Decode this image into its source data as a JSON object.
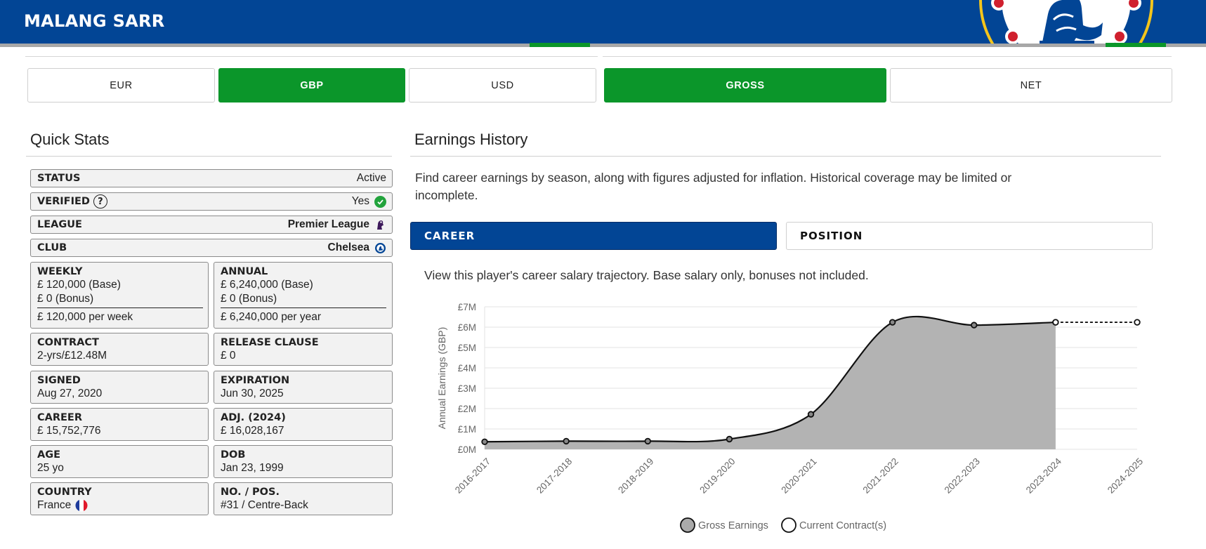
{
  "header": {
    "player_name": "MALANG SARR"
  },
  "currency_toggle": [
    "EUR",
    "GBP",
    "USD"
  ],
  "currency_active": "GBP",
  "pay_toggle": [
    "GROSS",
    "NET"
  ],
  "pay_active": "GROSS",
  "quick_stats": {
    "title": "Quick Stats",
    "rows": {
      "status": {
        "label": "STATUS",
        "value": "Active"
      },
      "verified": {
        "label": "VERIFIED",
        "help": "?",
        "value": "Yes"
      },
      "league": {
        "label": "LEAGUE",
        "value": "Premier League"
      },
      "club": {
        "label": "CLUB",
        "value": "Chelsea"
      }
    },
    "weekly": {
      "label": "WEEKLY",
      "base": "£ 120,000 (Base)",
      "bonus": "£ 0 (Bonus)",
      "total": "£ 120,000 per week"
    },
    "annual": {
      "label": "ANNUAL",
      "base": "£ 6,240,000 (Base)",
      "bonus": "£ 0 (Bonus)",
      "total": "£ 6,240,000 per year"
    },
    "contract": {
      "label": "CONTRACT",
      "value": "2-yrs/£12.48M"
    },
    "release_clause": {
      "label": "RELEASE CLAUSE",
      "value": "£ 0"
    },
    "signed": {
      "label": "SIGNED",
      "value": "Aug 27, 2020"
    },
    "expiration": {
      "label": "EXPIRATION",
      "value": "Jun 30, 2025"
    },
    "career": {
      "label": "CAREER",
      "value": "£ 15,752,776"
    },
    "adjusted": {
      "label": "ADJ. (2024)",
      "value": "£ 16,028,167"
    },
    "age": {
      "label": "AGE",
      "value": "25 yo"
    },
    "dob": {
      "label": "DOB",
      "value": "Jan 23, 1999"
    },
    "country": {
      "label": "COUNTRY",
      "value": "France"
    },
    "number_position": {
      "label": "NO. / POS.",
      "value": "#31 / Centre-Back"
    }
  },
  "earnings": {
    "title": "Earnings History",
    "intro": "Find career earnings by season, along with figures adjusted for inflation. Historical coverage may be limited or incomplete.",
    "tabs": [
      "CAREER",
      "POSITION"
    ],
    "active_tab": "CAREER",
    "chart_description": "View this player's career salary trajectory. Base salary only, bonuses not included."
  },
  "colors": {
    "header_blue": "#024595",
    "active_green": "#0b962a",
    "tab_blue": "#024595",
    "area_fill": "#b3b3b3",
    "line": "#111111"
  },
  "chart_data": {
    "type": "area",
    "categories": [
      "2016-2017",
      "2017-2018",
      "2018-2019",
      "2019-2020",
      "2020-2021",
      "2021-2022",
      "2022-2023",
      "2023-2024",
      "2024-2025"
    ],
    "series": [
      {
        "name": "Gross Earnings",
        "values": [
          0.37,
          0.4,
          0.4,
          0.5,
          1.72,
          6.24,
          6.1,
          6.24,
          null
        ]
      },
      {
        "name": "Current Contract(s)",
        "values": [
          null,
          null,
          null,
          null,
          null,
          null,
          null,
          6.24,
          6.24
        ]
      }
    ],
    "ylabel": "Annual Earnings (GBP)",
    "xlabel": "",
    "yticks": [
      "£0M",
      "£1M",
      "£2M",
      "£3M",
      "£4M",
      "£5M",
      "£6M",
      "£7M"
    ],
    "ylim": [
      0,
      7
    ],
    "grid": true,
    "legend_position": "bottom"
  }
}
